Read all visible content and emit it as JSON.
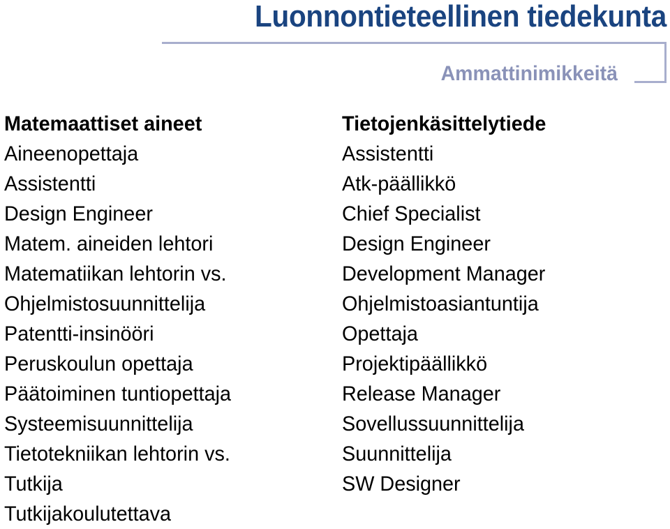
{
  "slide": {
    "title": "Luonnontieteellinen tiedekunta",
    "subtitle": "Ammattinimikkeitä",
    "colors": {
      "title": "#1a4480",
      "subtitle": "#8a92b8",
      "frame": "#a8aecd",
      "body_text": "#000000",
      "background": "#ffffff"
    }
  },
  "columns": [
    {
      "id": "matemaattiset-aineet",
      "heading": "Matemaattiset aineet",
      "items": [
        "Aineenopettaja",
        "Assistentti",
        "Design Engineer",
        "Matem. aineiden lehtori",
        "Matematiikan lehtorin vs.",
        "Ohjelmistosuunnittelija",
        "Patentti-insinööri",
        "Peruskoulun opettaja",
        "Päätoiminen tuntiopettaja",
        "Systeemisuunnittelija",
        "Tietotekniikan lehtorin vs.",
        "Tutkija",
        "Tutkijakoulutettava"
      ]
    },
    {
      "id": "tietojenkasittelytiede",
      "heading": "Tietojenkäsittelytiede",
      "items": [
        "Assistentti",
        "Atk-päällikkö",
        "Chief Specialist",
        "Design Engineer",
        "Development Manager",
        "Ohjelmistoasiantuntija",
        "Opettaja",
        "Projektipäällikkö",
        "Release Manager",
        "Sovellussuunnittelija",
        "Suunnittelija",
        "SW Designer"
      ]
    }
  ]
}
